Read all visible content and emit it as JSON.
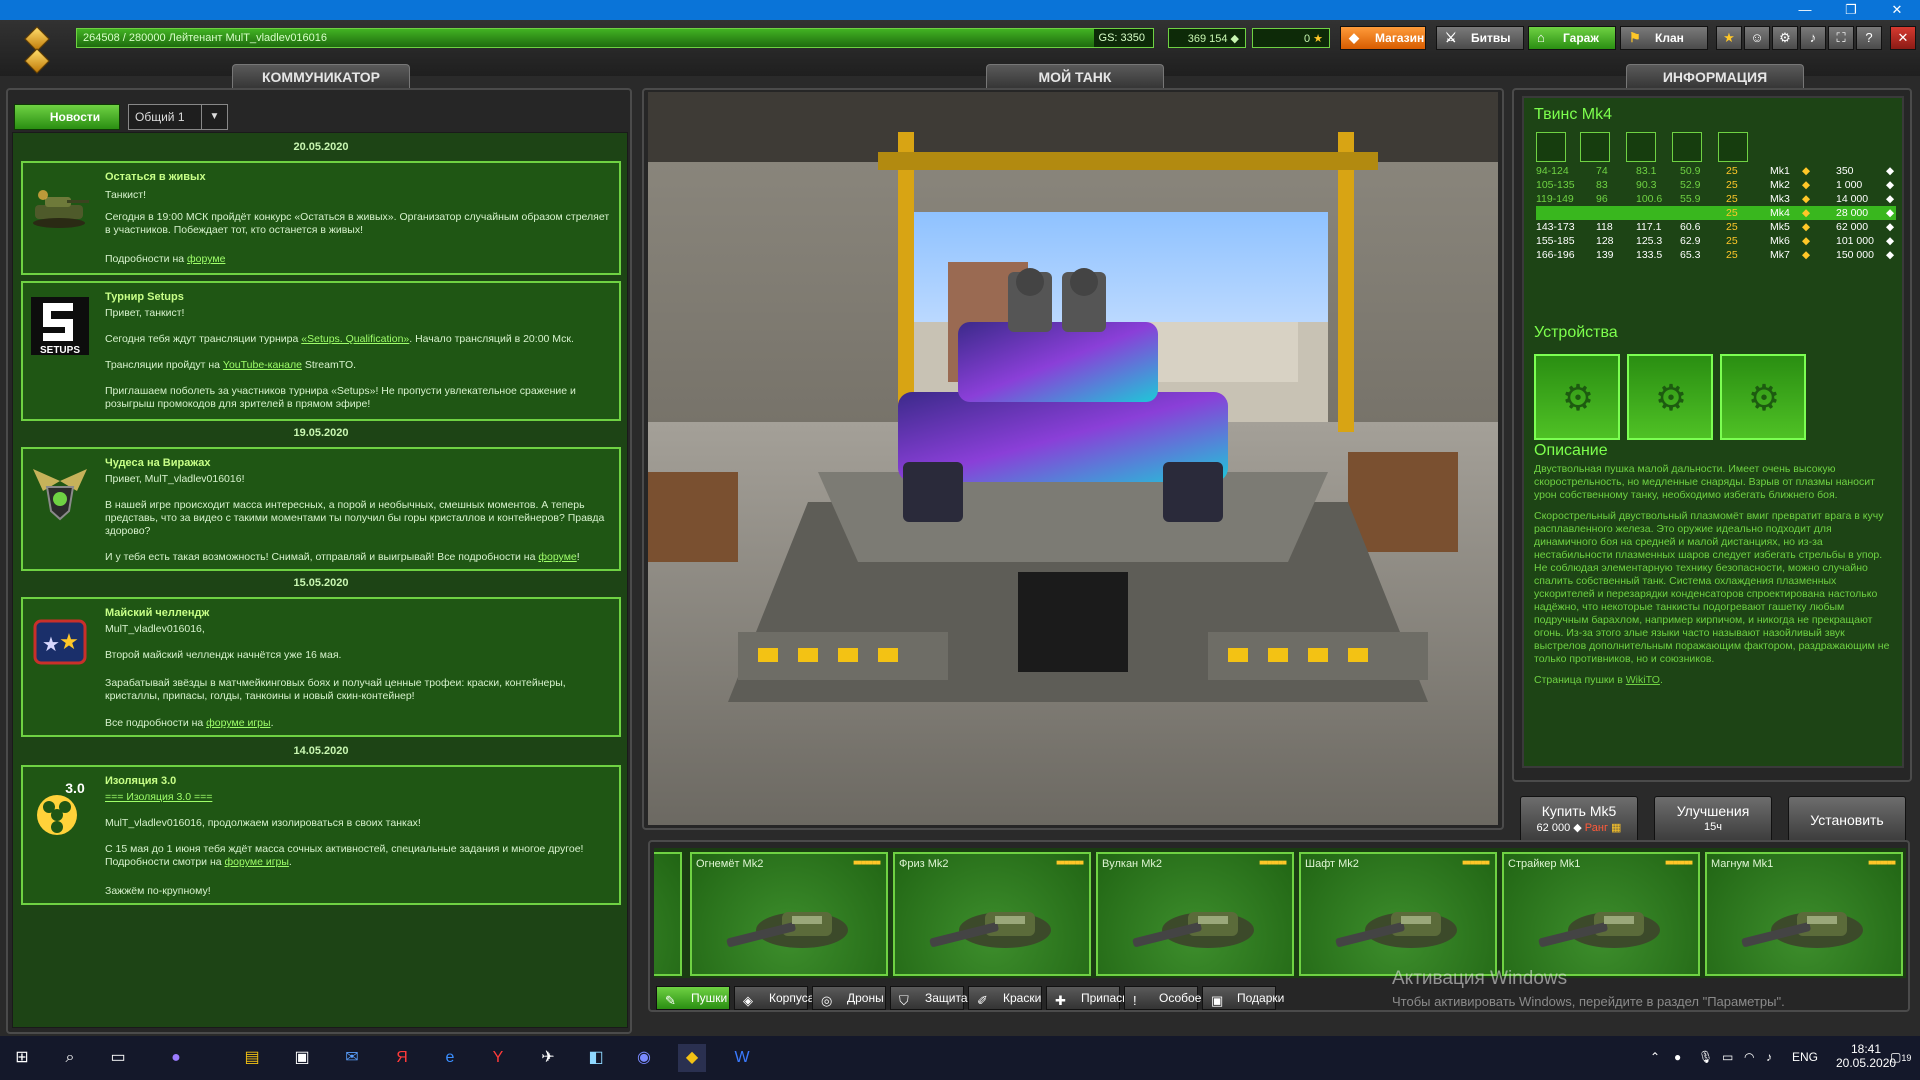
{
  "window": {
    "minimize": "—",
    "restore": "❐",
    "close": "✕"
  },
  "hud": {
    "xp_text": "264508 / 280000  Лейтенант MulT_vladlev016016",
    "xp_fraction": 0.945,
    "gs": "GS: 3350",
    "crystals": "369 154",
    "stars": "0",
    "buttons": {
      "shop": "Магазин",
      "battles": "Битвы",
      "garage": "Гараж",
      "clan": "Клан"
    }
  },
  "tabs": {
    "communicator": "КОММУНИКАТОР",
    "my_tank": "МОЙ ТАНК",
    "info": "ИНФОРМАЦИЯ"
  },
  "news": {
    "tab_label": "Новости",
    "channel": "Общий 1",
    "dates": [
      "20.05.2020",
      "19.05.2020",
      "15.05.2020",
      "14.05.2020"
    ],
    "items": [
      {
        "title": "Остаться в живых",
        "p1": "Танкист!",
        "p2": "Сегодня в 19:00 МСК пройдёт конкурс «Остаться в живых». Организатор случайным образом стреляет в участников. Побеждает тот, кто останется в живых!",
        "p3_pre": "Подробности на ",
        "p3_link": "форуме"
      },
      {
        "title": "Турнир  Setups",
        "p1": "Привет, танкист!",
        "p2_pre": "Сегодня тебя ждут трансляции турнира ",
        "p2_link": "«Setups. Qualification»",
        "p2_post": ". Начало трансляций в 20:00 Мск.",
        "p3_pre": "Трансляции пройдут на ",
        "p3_link": "YouTube-канале",
        "p3_post": " StreamTO.",
        "p4": "Приглашаем поболеть за участников турнира «Setups»! Не пропусти увлекательное сражение и розыгрыш промокодов для зрителей в прямом эфире!",
        "logo": "SETUPS"
      },
      {
        "title": "Чудеса на Виражах",
        "p1": "Привет, MulT_vladlev016016!",
        "p2": "В нашей игре происходит масса интересных, а порой и необычных, смешных моментов. А теперь представь, что за видео с такими моментами ты получил бы горы кристаллов и контейнеров? Правда здорово?",
        "p3_pre": " И у тебя есть такая возможность! Снимай, отправляй и выигрывай! Все подробности на ",
        "p3_link": "форуме",
        "p3_post": "!"
      },
      {
        "title": " Майский челлендж",
        "p1": "MulT_vladlev016016,",
        "p2": "Второй майский челлендж начнётся уже 16 мая.",
        "p3": "Зарабатывай звёзды в матчмейкинговых боях и получай ценные трофеи: краски, контейнеры, кристаллы, припасы, голды, танкоины и новый скин-контейнер!",
        "p4_pre": "Все подробности на  ",
        "p4_link": "форуме игры",
        "p4_post": "."
      },
      {
        "title": "Изоляция 3.0",
        "p1_link": "=== Изоляция 3.0 ===",
        "p2": "MulT_vladlev016016, продолжаем изолироваться в своих танках!",
        "p3_pre": "С 15 мая до 1 июня тебя ждёт масса сочных активностей, специальные задания и многое другое! Подробности смотри на ",
        "p3_link": "форуме игры",
        "p3_post": ".",
        "p4": "Зажжём по-крупному!",
        "badge": "3.0"
      }
    ]
  },
  "info": {
    "name": "Твинс Mk4",
    "stat_icons": [
      "damage-icon",
      "impact-icon",
      "reload-icon",
      "range-icon",
      "projectile-icon"
    ],
    "rows": [
      {
        "c1": "94-124",
        "c2": "74",
        "c3": "83.1",
        "c4": "50.9",
        "c5": "25",
        "mk": "Mk1",
        "price": "350"
      },
      {
        "c1": "105-135",
        "c2": "83",
        "c3": "90.3",
        "c4": "52.9",
        "c5": "25",
        "mk": "Mk2",
        "price": "1 000"
      },
      {
        "c1": "119-149",
        "c2": "96",
        "c3": "100.6",
        "c4": "55.9",
        "c5": "25",
        "mk": "Mk3",
        "price": "14 000"
      },
      {
        "c1": "",
        "c2": "",
        "c3": "",
        "c4": "",
        "c5": "25",
        "mk": "Mk4",
        "price": "28 000"
      },
      {
        "c1": "143-173",
        "c2": "118",
        "c3": "117.1",
        "c4": "60.6",
        "c5": "25",
        "mk": "Mk5",
        "price": "62 000"
      },
      {
        "c1": "155-185",
        "c2": "128",
        "c3": "125.3",
        "c4": "62.9",
        "c5": "25",
        "mk": "Mk6",
        "price": "101 000"
      },
      {
        "c1": "166-196",
        "c2": "139",
        "c3": "133.5",
        "c4": "65.3",
        "c5": "25",
        "mk": "Mk7",
        "price": "150 000"
      }
    ],
    "devices_title": "Устройства",
    "desc_title": "Описание",
    "desc_p1": "Двуствольная пушка малой дальности. Имеет очень высокую скорострельность, но медленные снаряды. Взрыв от плазмы наносит урон собственному танку, необходимо избегать ближнего боя.",
    "desc_p2": "Скорострельный двуствольный плазмомёт вмиг превратит врага в кучу расплавленного железа. Это оружие идеально подходит для динамичного боя на средней и малой дистанциях, но из-за нестабильности плазменных шаров следует избегать стрельбы в упор. Не соблюдая элементарную технику безопасности, можно случайно спалить собственный танк. Система охлаждения плазменных ускорителей и перезарядки конденсаторов спроектирована настолько надёжно, что некоторые танкисты подогревают гашетку любым подручным барахлом, например кирпичом, и никогда не прекращают огонь. Из-за этого злые языки часто называют назойливый звук выстрелов дополнительным поражающим фактором, раздражающим не только противников, но и союзников.",
    "desc_p3_pre": "Страница пушки в ",
    "desc_p3_link": "WikiTO",
    "desc_p3_post": "."
  },
  "actions": {
    "buy_label": "Купить Mk5",
    "buy_price": "62 000",
    "buy_rank": "Ранг",
    "upgrades_label": "Улучшения",
    "upgrades_sub": "15ч",
    "install_label": "Установить"
  },
  "equipment": {
    "cards": [
      {
        "name": "Огнемёт Mk2"
      },
      {
        "name": "Фриз Mk2"
      },
      {
        "name": "Вулкан Mk2"
      },
      {
        "name": "Шафт Mk2"
      },
      {
        "name": "Страйкер Mk1"
      },
      {
        "name": "Магнум Mk1"
      }
    ],
    "categories": [
      "Пушки",
      "Корпуса",
      "Дроны",
      "Защита",
      "Краски",
      "Припасы",
      "Особое",
      "Подарки"
    ]
  },
  "watermark": {
    "line1": "Активация Windows",
    "line2": "Чтобы активировать Windows, перейдите в раздел \"Параметры\"."
  },
  "taskbar": {
    "lang": "ENG",
    "time": "18:41",
    "date": "20.05.2020",
    "notif": "19"
  },
  "colors": {
    "accent": "#6fd243",
    "panel_green": "#1d4415",
    "shop": "#ff8a00",
    "garage": "#3fae1f",
    "clan": "#b12a22"
  }
}
